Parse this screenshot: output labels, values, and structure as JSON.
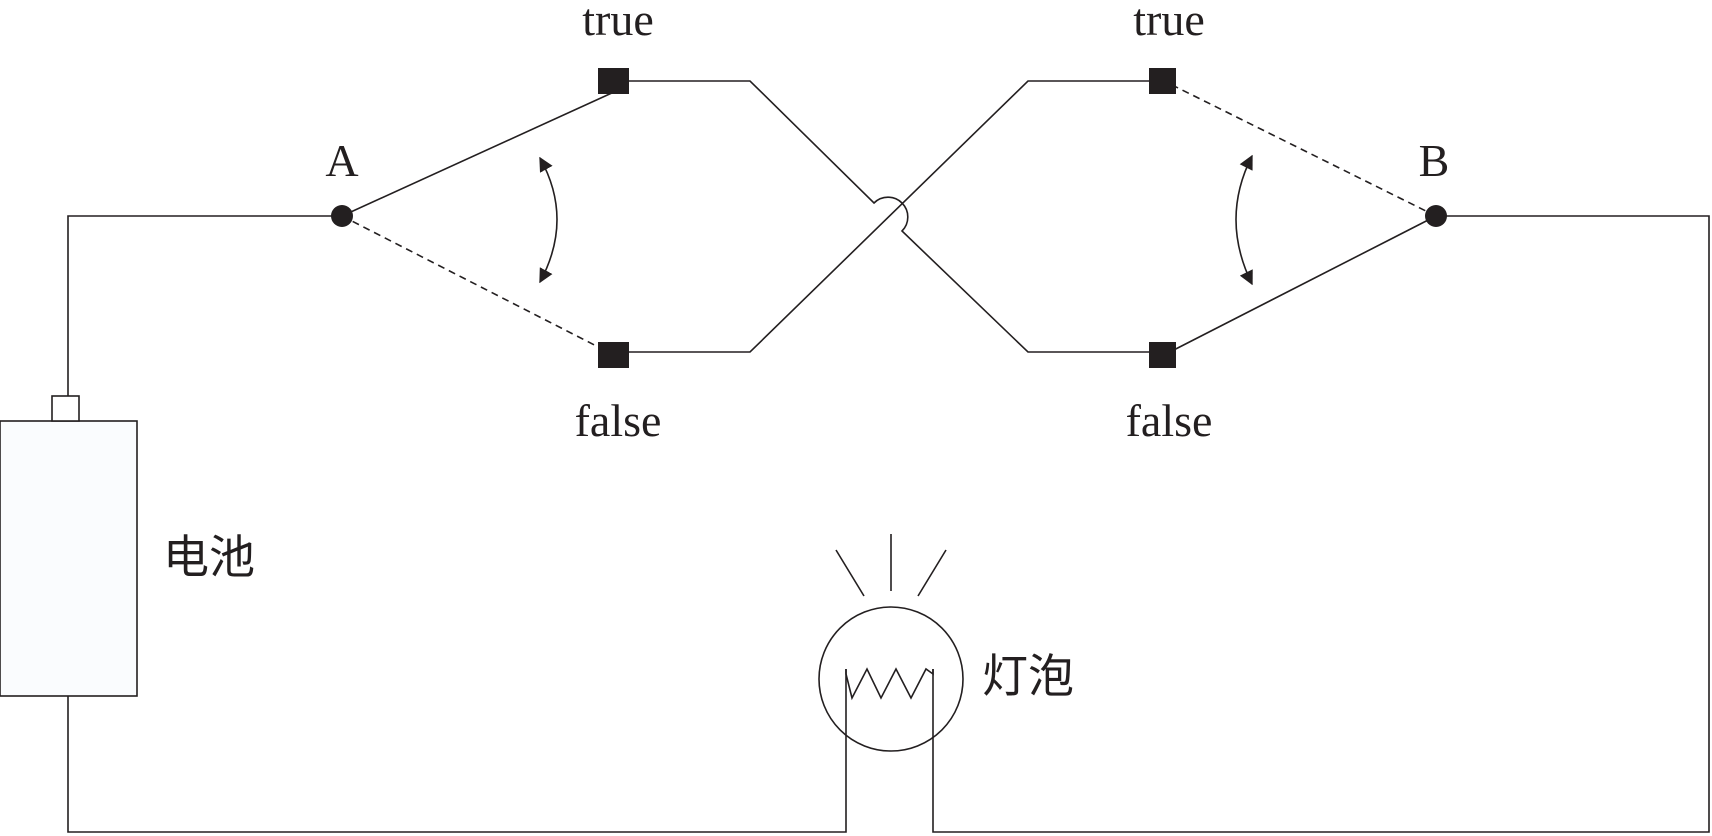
{
  "labels": {
    "switch_a": "A",
    "switch_b": "B",
    "a_true": "true",
    "a_false": "false",
    "b_true": "true",
    "b_false": "false",
    "battery": "电池",
    "bulb": "灯泡"
  },
  "colors": {
    "line": "#231f20",
    "battery_fill": "#fafcfe"
  }
}
